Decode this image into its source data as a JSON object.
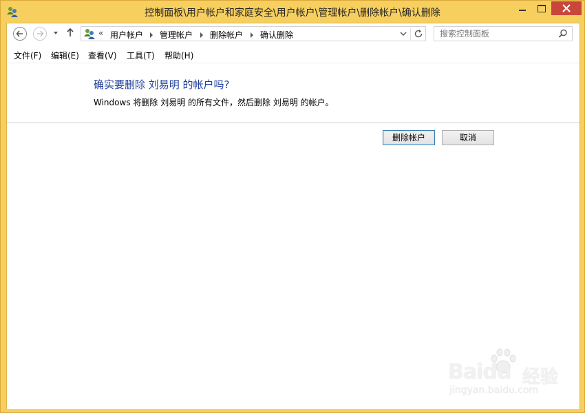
{
  "window": {
    "title": "控制面板\\用户帐户和家庭安全\\用户帐户\\管理帐户\\删除帐户\\确认删除"
  },
  "address_bar": {
    "overflow": "«",
    "crumbs": [
      "用户帐户",
      "管理帐户",
      "删除帐户",
      "确认删除"
    ]
  },
  "search": {
    "placeholder": "搜索控制面板"
  },
  "menu": [
    "文件(F)",
    "编辑(E)",
    "查看(V)",
    "工具(T)",
    "帮助(H)"
  ],
  "content": {
    "heading": "确实要删除 刘易明 的帐户吗?",
    "description": "Windows 将删除 刘易明 的所有文件，然后删除 刘易明 的帐户。",
    "buttons": {
      "delete": "删除帐户",
      "cancel": "取消"
    }
  },
  "watermark": {
    "logo": "Baidu",
    "brand": "经验",
    "url": "jingyan.baidu.com"
  },
  "colors": {
    "window_frame": "#f6cf5f",
    "heading_blue": "#1f3f9c",
    "close_red": "#c9473a"
  }
}
